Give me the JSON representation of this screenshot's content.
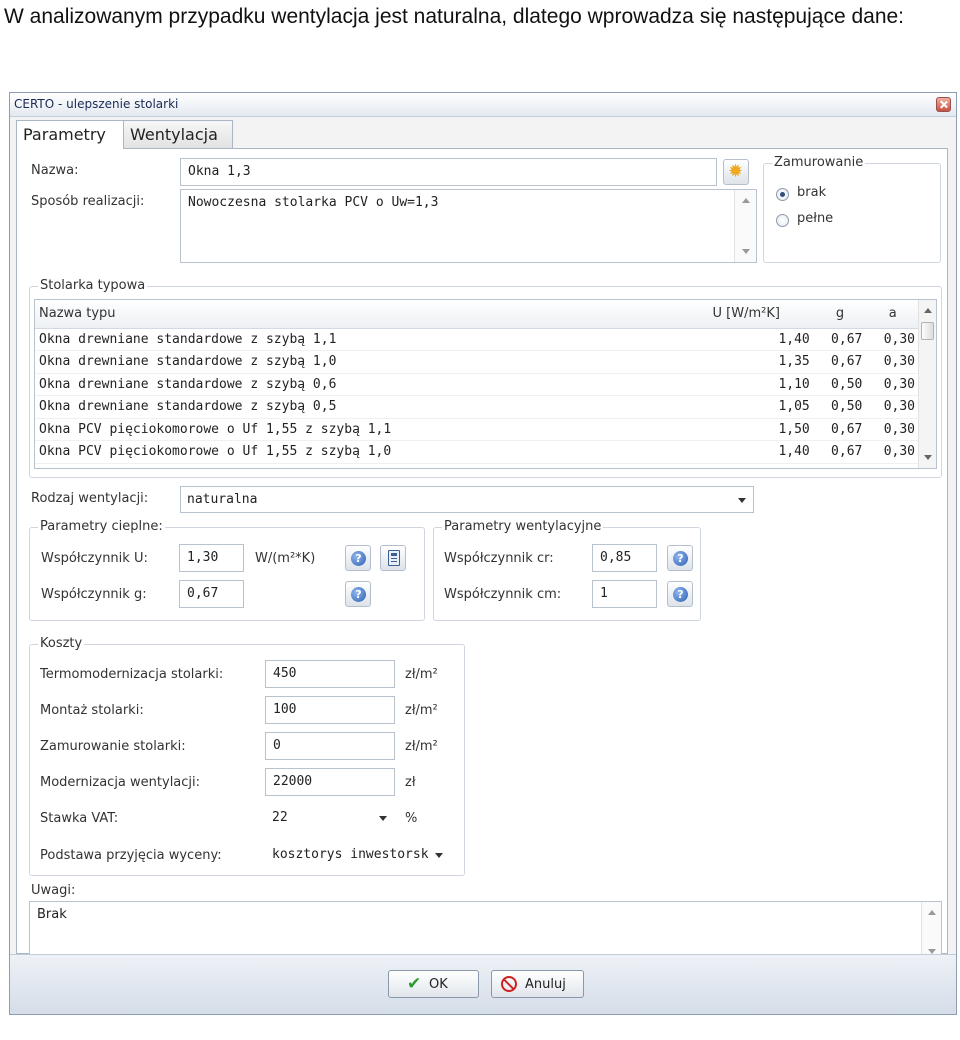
{
  "intro": "W analizowanym przypadku wentylacja jest naturalna, dlatego wprowadza się następujące dane:",
  "window": {
    "title": "CERTO - ulepszenie stolarki"
  },
  "tabs": [
    {
      "label": "Parametry",
      "active": true
    },
    {
      "label": "Wentylacja",
      "active": false
    }
  ],
  "form": {
    "name_label": "Nazwa:",
    "name_value": "Okna 1,3",
    "realization_label": "Sposób realizacji:",
    "realization_value": "Nowoczesna stolarka PCV o Uw=1,3"
  },
  "zamurowanie": {
    "title": "Zamurowanie",
    "options": [
      {
        "label": "brak",
        "selected": true
      },
      {
        "label": "pełne",
        "selected": false
      }
    ]
  },
  "stolarka": {
    "title": "Stolarka typowa",
    "columns": [
      "Nazwa typu",
      "U [W/m²K]",
      "g",
      "a"
    ],
    "rows": [
      [
        "Okna drewniane standardowe z szybą 1,1",
        "1,40",
        "0,67",
        "0,30"
      ],
      [
        "Okna drewniane standardowe z szybą 1,0",
        "1,35",
        "0,67",
        "0,30"
      ],
      [
        "Okna drewniane standardowe z szybą 0,6",
        "1,10",
        "0,50",
        "0,30"
      ],
      [
        "Okna drewniane standardowe z szybą 0,5",
        "1,05",
        "0,50",
        "0,30"
      ],
      [
        "Okna PCV pięciokomorowe o Uf 1,55 z szybą 1,1",
        "1,50",
        "0,67",
        "0,30"
      ],
      [
        "Okna PCV pięciokomorowe o Uf 1,55 z szybą 1,0",
        "1,40",
        "0,67",
        "0,30"
      ]
    ]
  },
  "wentylacja": {
    "label": "Rodzaj wentylacji:",
    "value": "naturalna"
  },
  "cieplne": {
    "title": "Parametry cieplne:",
    "u_label": "Współczynnik U:",
    "u_value": "1,30",
    "u_unit": "W/(m²*K)",
    "g_label": "Współczynnik g:",
    "g_value": "0,67"
  },
  "wentylacyjne": {
    "title": "Parametry wentylacyjne",
    "cr_label": "Współczynnik cr:",
    "cr_value": "0,85",
    "cm_label": "Współczynnik cm:",
    "cm_value": "1"
  },
  "koszty": {
    "title": "Koszty",
    "rows": [
      {
        "label": "Termomodernizacja stolarki:",
        "value": "450",
        "unit": "zł/m²"
      },
      {
        "label": "Montaż stolarki:",
        "value": "100",
        "unit": "zł/m²"
      },
      {
        "label": "Zamurowanie stolarki:",
        "value": "0",
        "unit": "zł/m²"
      },
      {
        "label": "Modernizacja wentylacji:",
        "value": "22000",
        "unit": "zł"
      }
    ],
    "vat_label": "Stawka VAT:",
    "vat_value": "22",
    "vat_unit": "%",
    "basis_label": "Podstawa przyjęcia wyceny:",
    "basis_value": "kosztorys inwestorsk"
  },
  "uwagi": {
    "label": "Uwagi:",
    "value": "Brak"
  },
  "buttons": {
    "ok": "OK",
    "cancel": "Anuluj"
  }
}
